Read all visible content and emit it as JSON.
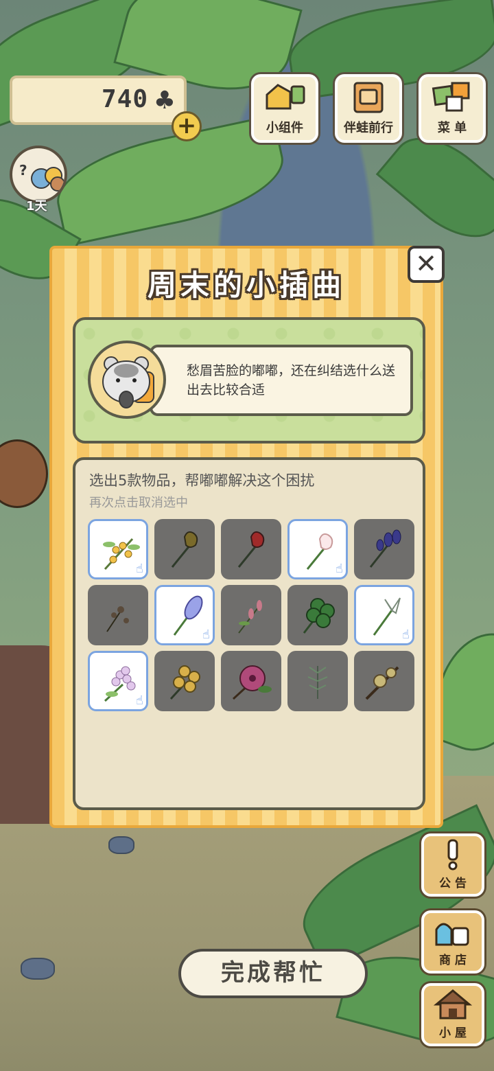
{
  "hud": {
    "clover_count": "740",
    "clover_icon": "clover-icon"
  },
  "top_buttons": [
    {
      "label": "小组件"
    },
    {
      "label": "伴蛙前行"
    },
    {
      "label": "菜 单"
    }
  ],
  "avatar": {
    "question_mark": "?",
    "day_label": "1天"
  },
  "side_buttons": [
    {
      "label": "公 告"
    },
    {
      "label": "商 店"
    },
    {
      "label": "小 屋"
    }
  ],
  "dialog": {
    "title": "周末的小插曲",
    "close_label": "✕",
    "story_text": "愁眉苦脸的嘟嘟，还在纠结选什么送出去比较合适",
    "task_title": "选出5款物品，帮嘟嘟解决这个困扰",
    "task_hint": "再次点击取消选中",
    "done_label": "完成帮忙",
    "items": [
      {
        "icon": "osmanthus-icon",
        "selected": true
      },
      {
        "icon": "brown-tulip-icon",
        "selected": false
      },
      {
        "icon": "red-tulip-icon",
        "selected": false
      },
      {
        "icon": "white-tulip-icon",
        "selected": true
      },
      {
        "icon": "iris-icon",
        "selected": false
      },
      {
        "icon": "dried-flower-icon",
        "selected": false
      },
      {
        "icon": "hyacinth-icon",
        "selected": true
      },
      {
        "icon": "pink-sprig-icon",
        "selected": false
      },
      {
        "icon": "four-leaf-clover-icon",
        "selected": false
      },
      {
        "icon": "lily-icon",
        "selected": true
      },
      {
        "icon": "lilac-icon",
        "selected": true
      },
      {
        "icon": "yellow-flower-icon",
        "selected": false
      },
      {
        "icon": "hibiscus-icon",
        "selected": false
      },
      {
        "icon": "herb-icon",
        "selected": false
      },
      {
        "icon": "plum-blossom-icon",
        "selected": false
      }
    ]
  },
  "colors": {
    "dialog_stripe_a": "#f6c766",
    "dialog_stripe_b": "#fadc8f",
    "selected_border": "#7ba4e0",
    "unselected_cell": "#6f6e6c"
  }
}
